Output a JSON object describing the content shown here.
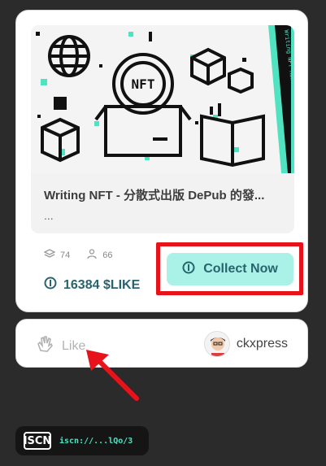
{
  "nft_card": {
    "title_line1": "Writing NFT - 分散式出版 DePub 的發...",
    "title_line2": "...",
    "cover_banner_text": "Writing NFT Rewrite the publishing era",
    "owners_count": "74",
    "collectors_count": "66",
    "price": "16384 $LIKE",
    "collect_label": "Collect Now"
  },
  "like_bar": {
    "like_label": "Like",
    "author_name": "ckxpress"
  },
  "iscn": {
    "logo_text": "ISCN",
    "link_text": "iscn://...lQo/3"
  },
  "colors": {
    "accent": "#aaf1e7",
    "accent_text": "#28646e",
    "highlight": "#e8121b",
    "iscn_link": "#50e3c2",
    "banner": "#50e3c2"
  }
}
